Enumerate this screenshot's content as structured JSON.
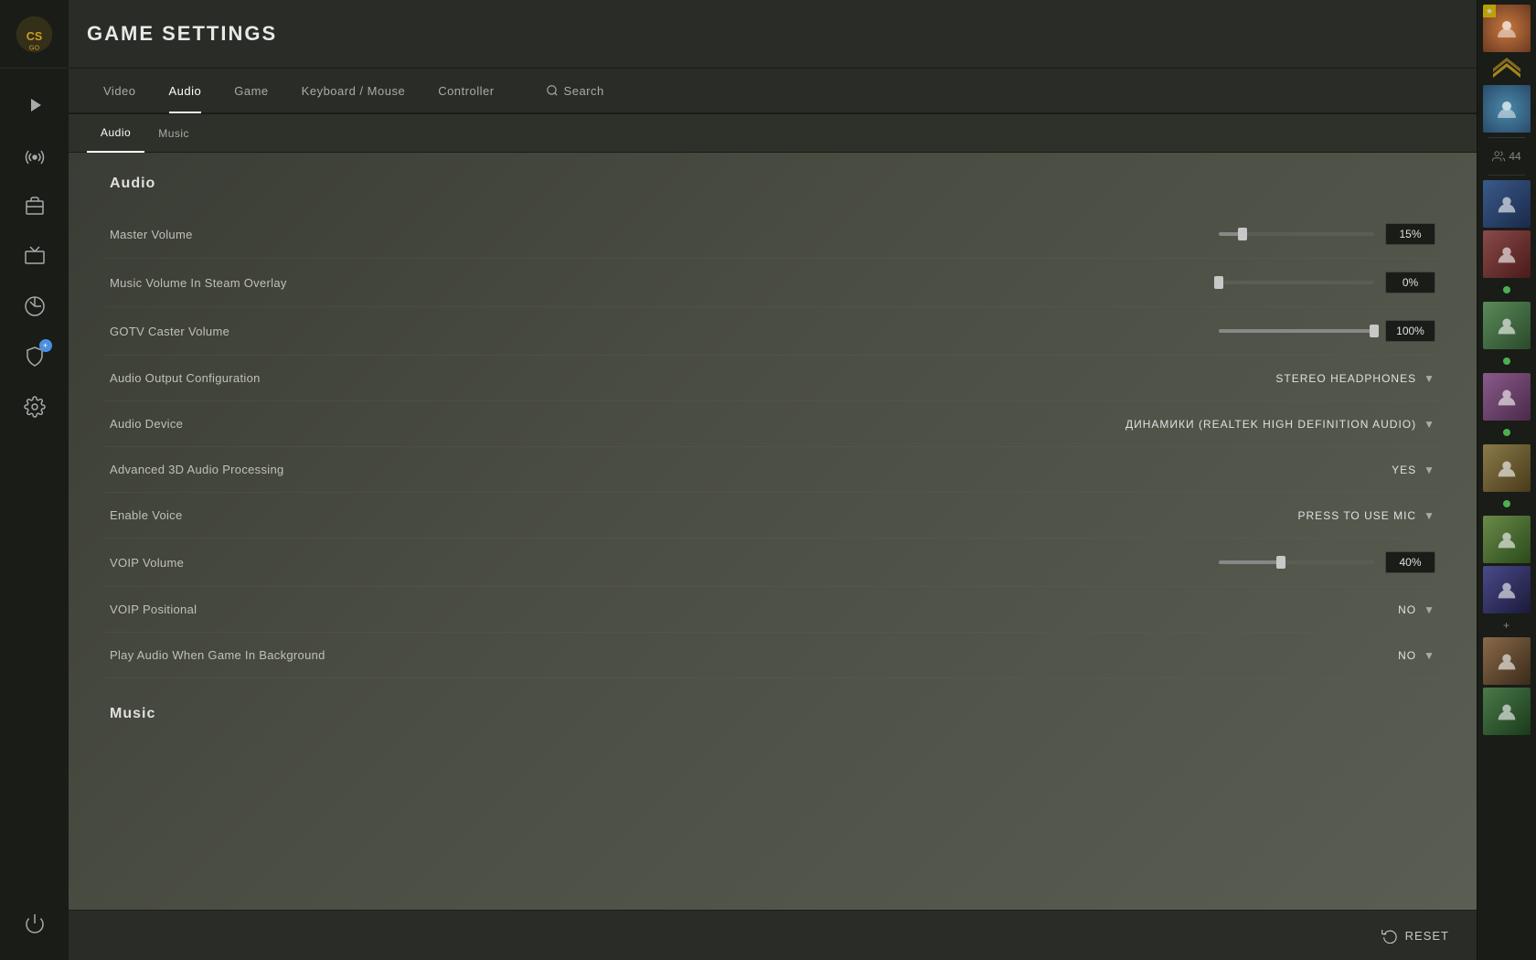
{
  "header": {
    "title": "GAME SETTINGS"
  },
  "nav": {
    "tabs": [
      {
        "id": "video",
        "label": "Video",
        "active": false
      },
      {
        "id": "audio",
        "label": "Audio",
        "active": true
      },
      {
        "id": "game",
        "label": "Game",
        "active": false
      },
      {
        "id": "keyboard-mouse",
        "label": "Keyboard / Mouse",
        "active": false
      },
      {
        "id": "controller",
        "label": "Controller",
        "active": false
      },
      {
        "id": "search",
        "label": "Search",
        "active": false
      }
    ],
    "sub_tabs": [
      {
        "id": "audio",
        "label": "Audio",
        "active": true
      },
      {
        "id": "music",
        "label": "Music",
        "active": false
      }
    ]
  },
  "settings": {
    "sections": [
      {
        "id": "audio",
        "title": "Audio",
        "rows": [
          {
            "id": "master-volume",
            "label": "Master Volume",
            "type": "slider",
            "value": "15%",
            "percent": 15
          },
          {
            "id": "music-volume-overlay",
            "label": "Music Volume In Steam Overlay",
            "type": "slider",
            "value": "0%",
            "percent": 0
          },
          {
            "id": "gotv-caster-volume",
            "label": "GOTV Caster Volume",
            "type": "slider",
            "value": "100%",
            "percent": 100
          },
          {
            "id": "audio-output-config",
            "label": "Audio Output Configuration",
            "type": "dropdown",
            "value": "STEREO HEADPHONES"
          },
          {
            "id": "audio-device",
            "label": "Audio Device",
            "type": "dropdown",
            "value": "ДИНАМИКИ (REALTEK HIGH DEFINITION AUDIO)"
          },
          {
            "id": "advanced-3d-audio",
            "label": "Advanced 3D Audio Processing",
            "type": "dropdown",
            "value": "YES"
          },
          {
            "id": "enable-voice",
            "label": "Enable Voice",
            "type": "dropdown",
            "value": "PRESS TO USE MIC"
          },
          {
            "id": "voip-volume",
            "label": "VOIP Volume",
            "type": "slider",
            "value": "40%",
            "percent": 40
          },
          {
            "id": "voip-positional",
            "label": "VOIP Positional",
            "type": "dropdown",
            "value": "NO"
          },
          {
            "id": "play-audio-background",
            "label": "Play Audio When Game In Background",
            "type": "dropdown",
            "value": "NO"
          }
        ]
      },
      {
        "id": "music",
        "title": "Music",
        "rows": []
      }
    ]
  },
  "bottom_bar": {
    "reset_label": "RESET"
  },
  "sidebar_icons": [
    {
      "id": "play",
      "icon": "▶",
      "active": false
    },
    {
      "id": "broadcast",
      "icon": "📡",
      "active": false
    },
    {
      "id": "inventory",
      "icon": "🎒",
      "active": false
    },
    {
      "id": "tv",
      "icon": "📺",
      "active": false
    },
    {
      "id": "stats",
      "icon": "📊",
      "active": false
    },
    {
      "id": "shield",
      "icon": "🛡",
      "active": false
    },
    {
      "id": "settings",
      "icon": "⚙",
      "active": false
    }
  ],
  "friends": {
    "count": 44,
    "items": [
      {
        "color": "#c8783c",
        "icon": "👤"
      },
      {
        "color": "#5a8a6a",
        "icon": "👤"
      },
      {
        "color": "#7a5a8a",
        "icon": "👤"
      },
      {
        "color": "#8a3a3a",
        "icon": "👤"
      },
      {
        "color": "#3a6a8a",
        "icon": "👤"
      },
      {
        "color": "#8a7a3a",
        "icon": "👤"
      },
      {
        "color": "#4a8a4a",
        "icon": "👤"
      },
      {
        "color": "#8a4a6a",
        "icon": "👤"
      },
      {
        "color": "#6a3a3a",
        "icon": "👤"
      },
      {
        "color": "#3a4a8a",
        "icon": "👤"
      },
      {
        "color": "#7a8a3a",
        "icon": "👤"
      },
      {
        "color": "#8a5a3a",
        "icon": "👤"
      }
    ]
  }
}
